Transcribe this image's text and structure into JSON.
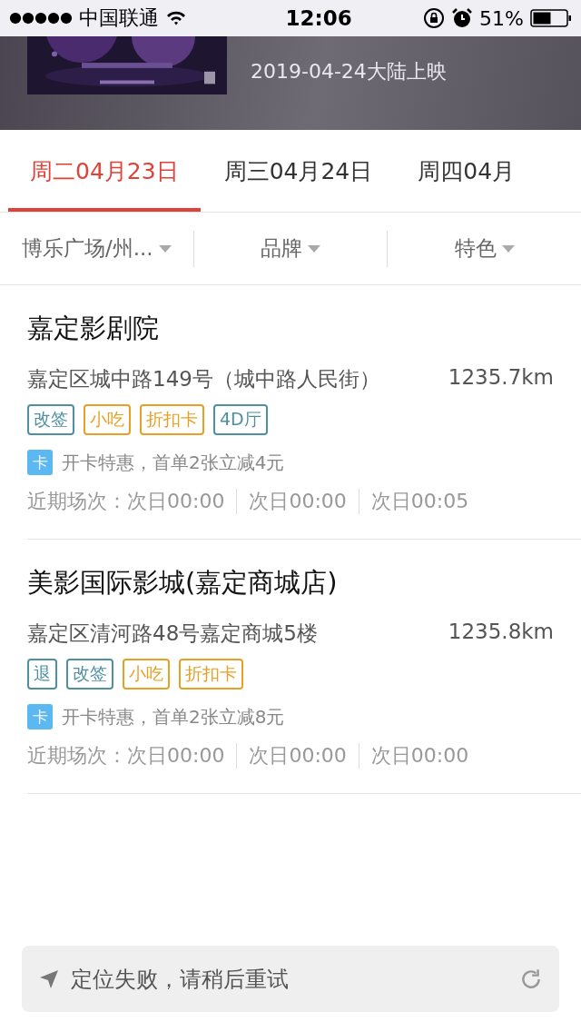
{
  "status_bar": {
    "carrier": "中国联通",
    "time": "12:06",
    "battery_percent": "51%"
  },
  "movie_header": {
    "release": "2019-04-24大陆上映"
  },
  "date_tabs": [
    {
      "label": "周二04月23日",
      "selected": true
    },
    {
      "label": "周三04月24日",
      "selected": false
    },
    {
      "label": "周四04月",
      "selected": false
    }
  ],
  "filters": [
    {
      "label": "博乐广场/州..."
    },
    {
      "label": "品牌"
    },
    {
      "label": "特色"
    }
  ],
  "cinemas": [
    {
      "name": "嘉定影剧院",
      "address": "嘉定区城中路149号（城中路人民街）",
      "distance": "1235.7km",
      "tags": [
        {
          "label": "改签",
          "color": "#4e8fa0"
        },
        {
          "label": "小吃",
          "color": "#e8a024"
        },
        {
          "label": "折扣卡",
          "color": "#e8a024"
        },
        {
          "label": "4D厅",
          "color": "#4e8fa0"
        }
      ],
      "promo_badge": "卡",
      "promo": "开卡特惠，首单2张立减4元",
      "showtimes_label": "近期场次：",
      "showtimes": [
        "次日00:00",
        "次日00:00",
        "次日00:05"
      ]
    },
    {
      "name": "美影国际影城(嘉定商城店)",
      "address": "嘉定区清河路48号嘉定商城5楼",
      "distance": "1235.8km",
      "tags": [
        {
          "label": "退",
          "color": "#4e8fa0"
        },
        {
          "label": "改签",
          "color": "#4e8fa0"
        },
        {
          "label": "小吃",
          "color": "#e8a024"
        },
        {
          "label": "折扣卡",
          "color": "#e8a024"
        }
      ],
      "promo_badge": "卡",
      "promo": "开卡特惠，首单2张立减8元",
      "showtimes_label": "近期场次：",
      "showtimes": [
        "次日00:00",
        "次日00:00",
        "次日00:00"
      ]
    }
  ],
  "location_bar": {
    "message": "定位失败，请稍后重试"
  }
}
